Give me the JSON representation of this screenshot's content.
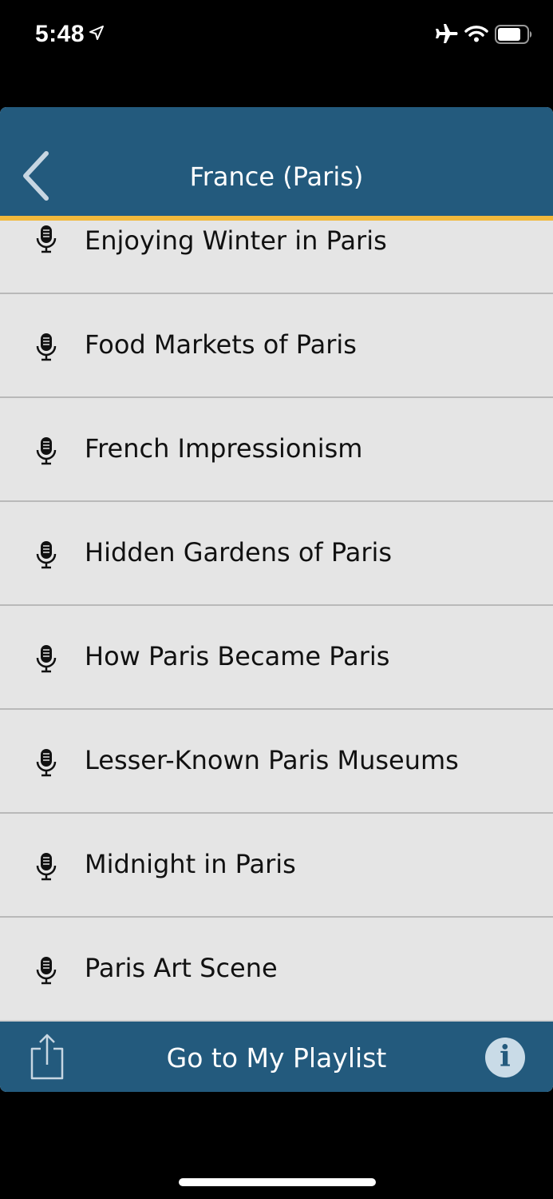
{
  "status_bar": {
    "time": "5:48",
    "icons": [
      "location-arrow-icon",
      "airplane-icon",
      "wifi-icon",
      "battery-icon"
    ]
  },
  "header": {
    "title": "France (Paris)",
    "back_icon": "chevron-left-icon"
  },
  "items": [
    {
      "label": "Enjoying Winter in Paris",
      "icon": "microphone-icon"
    },
    {
      "label": "Food Markets of Paris",
      "icon": "microphone-icon"
    },
    {
      "label": "French Impressionism",
      "icon": "microphone-icon"
    },
    {
      "label": "Hidden Gardens of Paris",
      "icon": "microphone-icon"
    },
    {
      "label": "How Paris Became Paris",
      "icon": "microphone-icon"
    },
    {
      "label": "Lesser-Known Paris Museums",
      "icon": "microphone-icon"
    },
    {
      "label": "Midnight in Paris",
      "icon": "microphone-icon"
    },
    {
      "label": "Paris Art Scene",
      "icon": "microphone-icon"
    }
  ],
  "bottom_bar": {
    "playlist_label": "Go to My Playlist",
    "share_icon": "share-icon",
    "info_icon": "info-icon",
    "info_glyph": "i"
  },
  "colors": {
    "header_bg": "#235a7d",
    "accent": "#f2b93b",
    "list_bg": "#e5e5e5"
  }
}
